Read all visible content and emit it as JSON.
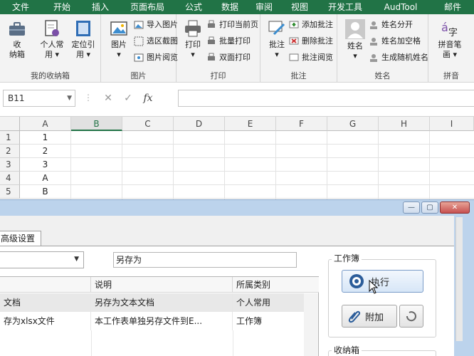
{
  "ribbon_tabs": [
    "文件",
    "开始",
    "插入",
    "页面布局",
    "公式",
    "数据",
    "审阅",
    "视图",
    "开发工具",
    "AudTool",
    "邮件"
  ],
  "ribbon": {
    "groups": [
      {
        "label": "我的收纳箱"
      },
      {
        "label": "图片"
      },
      {
        "label": "打印"
      },
      {
        "label": "批注"
      },
      {
        "label": "姓名"
      },
      {
        "label": "拼音"
      }
    ],
    "big_buttons": {
      "shou_na": "收\n纳箱",
      "ge_ren": "个人常\n用 ▾",
      "ding_wei": "定位引\n用 ▾",
      "tu_pian": "图片\n▾",
      "da_yin": "打印\n▾",
      "pi_zhu": "批注\n▾",
      "xing_ming": "姓名\n▾",
      "pin_yin": "拼音笔\n画 ▾"
    },
    "small_buttons": {
      "import_pic": "导入图片",
      "select_capture": "选区截图",
      "pic_browse": "图片阅览",
      "print_current": "打印当前页",
      "batch_print": "批量打印",
      "duplex_print": "双面打印",
      "add_comment": "添加批注",
      "delete_comment": "删除批注",
      "comment_browse": "批注阅览",
      "name_split": "姓名分开",
      "name_space": "姓名加空格",
      "random_name": "生成随机姓名"
    }
  },
  "formula_bar": {
    "name_box": "B11",
    "fx": "fx",
    "cancel": "✕",
    "enter": "✓"
  },
  "grid": {
    "columns": [
      "A",
      "B",
      "C",
      "D",
      "E",
      "F",
      "G",
      "H",
      "I"
    ],
    "selected_column": "B",
    "rows": [
      {
        "num": "1",
        "a": "1"
      },
      {
        "num": "2",
        "a": "2"
      },
      {
        "num": "3",
        "a": "3"
      },
      {
        "num": "4",
        "a": "A"
      },
      {
        "num": "5",
        "a": "B"
      }
    ]
  },
  "dialog": {
    "tab_label": "高级设置",
    "search_value": "另存为",
    "table": {
      "headers": [
        "",
        "说明",
        "所属类别"
      ],
      "rows": [
        [
          "文档",
          "另存为文本文档",
          "个人常用"
        ],
        [
          "存为xlsx文件",
          "本工作表单独另存文件到E...",
          "工作簿"
        ]
      ]
    },
    "workbook_group": "工作簿",
    "execute_label": "执行",
    "attach_label": "附加",
    "storage_group": "收纳箱",
    "window_controls": {
      "minimize": "—",
      "maximize": "▢",
      "close": "✕"
    }
  },
  "colors": {
    "excel_green": "#217346",
    "dialog_frame": "#bcd3ec"
  }
}
